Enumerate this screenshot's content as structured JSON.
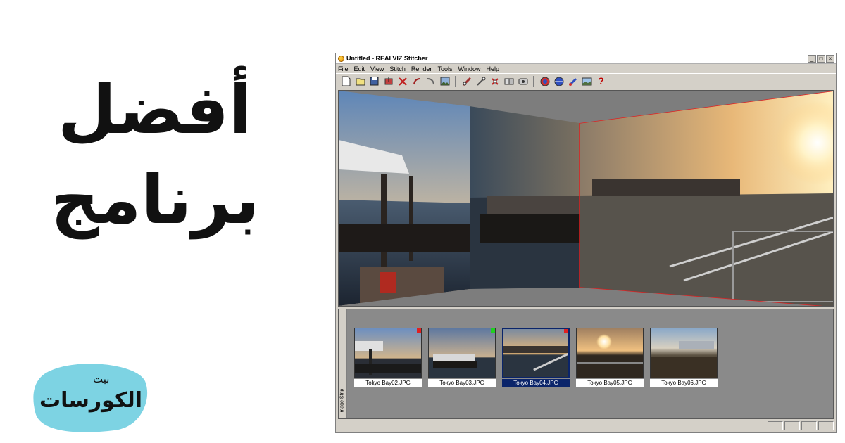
{
  "headline": {
    "line1": "أفضل",
    "line2": "برنامج"
  },
  "logo": {
    "small": "بيت",
    "main": "الكورسات",
    "bg_color": "#7dd3e3"
  },
  "window": {
    "title": "Untitled - REALVIZ Stitcher",
    "controls": [
      "_",
      "□",
      "×"
    ],
    "menu": [
      "File",
      "Edit",
      "View",
      "Stitch",
      "Render",
      "Tools",
      "Window",
      "Help"
    ],
    "toolbar_icons": [
      "new-file-icon",
      "open-file-icon",
      "save-icon",
      "import-icon",
      "cut-icon",
      "undo-icon",
      "redo-icon",
      "image-icon",
      "stitch-icon",
      "align-icon",
      "delete-stitch-icon",
      "auto-stitch-icon",
      "view-icon",
      "render-icon",
      "sphere-icon",
      "brush-icon",
      "panorama-icon",
      "help-icon"
    ],
    "strip_label": "Image Strip",
    "thumbnails": [
      {
        "caption": "Tokyo Bay02.JPG",
        "marker_color": "#e02020",
        "selected": false
      },
      {
        "caption": "Tokyo Bay03.JPG",
        "marker_color": "#20d020",
        "selected": false
      },
      {
        "caption": "Tokyo Bay04.JPG",
        "marker_color": "#e02020",
        "selected": true
      },
      {
        "caption": "Tokyo Bay05.JPG",
        "marker_color": "",
        "selected": false
      },
      {
        "caption": "Tokyo Bay06.JPG",
        "marker_color": "",
        "selected": false
      }
    ]
  }
}
